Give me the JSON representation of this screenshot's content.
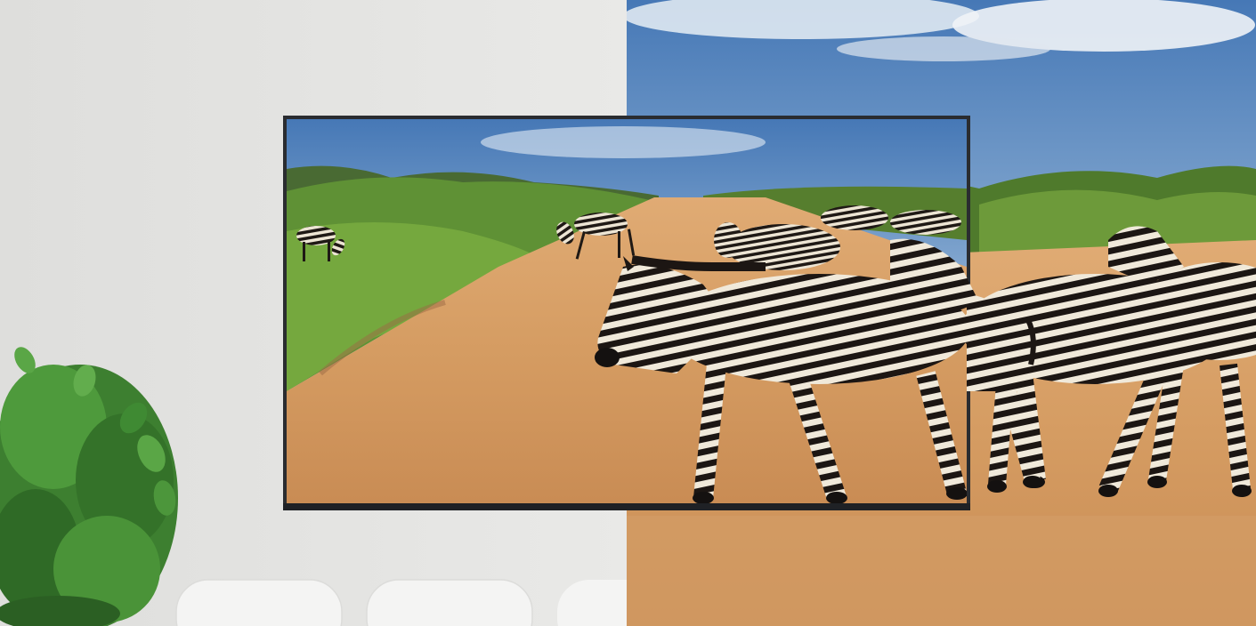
{
  "image": {
    "kind": "product-marketing-photo",
    "description_visible": false,
    "colors": {
      "wall": "#e4e4e2",
      "sky_top": "#4f7fb8",
      "sky_bottom": "#c8daea",
      "savanna_road": "#d49a62",
      "grass": "#6c9a32",
      "tv_bezel": "#2a2c30",
      "stripe_dark": "#1d1714",
      "stripe_light": "#efe7d6",
      "plant": "#3e8a34"
    }
  }
}
